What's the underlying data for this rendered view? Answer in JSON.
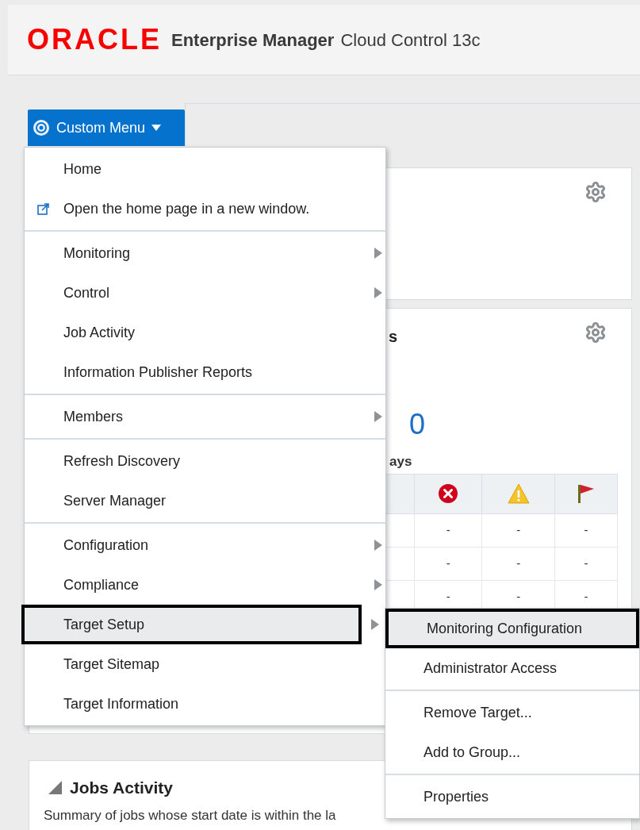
{
  "header": {
    "logo": "ORACLE",
    "product": "Enterprise Manager",
    "subtitle": "Cloud Control 13c"
  },
  "menu_button": {
    "label": "Custom Menu"
  },
  "menu": {
    "groups": [
      [
        {
          "label": "Home",
          "submenu": false,
          "selected": false,
          "external": false
        },
        {
          "label": "Open the home page in a new window.",
          "submenu": false,
          "selected": false,
          "external": true
        }
      ],
      [
        {
          "label": "Monitoring",
          "submenu": true,
          "selected": false,
          "external": false
        },
        {
          "label": "Control",
          "submenu": true,
          "selected": false,
          "external": false
        },
        {
          "label": "Job Activity",
          "submenu": false,
          "selected": false,
          "external": false
        },
        {
          "label": "Information Publisher Reports",
          "submenu": false,
          "selected": false,
          "external": false
        }
      ],
      [
        {
          "label": "Members",
          "submenu": true,
          "selected": false,
          "external": false
        }
      ],
      [
        {
          "label": "Refresh Discovery",
          "submenu": false,
          "selected": false,
          "external": false
        },
        {
          "label": "Server Manager",
          "submenu": false,
          "selected": false,
          "external": false
        }
      ],
      [
        {
          "label": "Configuration",
          "submenu": true,
          "selected": false,
          "external": false
        },
        {
          "label": "Compliance",
          "submenu": true,
          "selected": false,
          "external": false
        },
        {
          "label": "Target Setup",
          "submenu": true,
          "selected": true,
          "external": false
        },
        {
          "label": "Target Sitemap",
          "submenu": false,
          "selected": false,
          "external": false
        },
        {
          "label": "Target Information",
          "submenu": false,
          "selected": false,
          "external": false
        }
      ]
    ]
  },
  "submenu": {
    "groups": [
      [
        {
          "label": "Monitoring Configuration",
          "selected": true
        },
        {
          "label": "Administrator Access",
          "selected": false
        }
      ],
      [
        {
          "label": "Remove Target...",
          "selected": false
        },
        {
          "label": "Add to Group...",
          "selected": false
        }
      ],
      [
        {
          "label": "Properties",
          "selected": false
        }
      ]
    ]
  },
  "incidents_panel": {
    "title": "s",
    "count": "0",
    "period": "ays",
    "columns": [
      {
        "kind": "error"
      },
      {
        "kind": "warning"
      },
      {
        "kind": "flag"
      }
    ],
    "rows": [
      [
        "-",
        "-",
        "-"
      ],
      [
        "-",
        "-",
        "-"
      ],
      [
        "-",
        "-",
        "-"
      ]
    ]
  },
  "jobs_panel": {
    "title": "Jobs Activity",
    "summary": "Summary of jobs whose start date is within the la"
  }
}
